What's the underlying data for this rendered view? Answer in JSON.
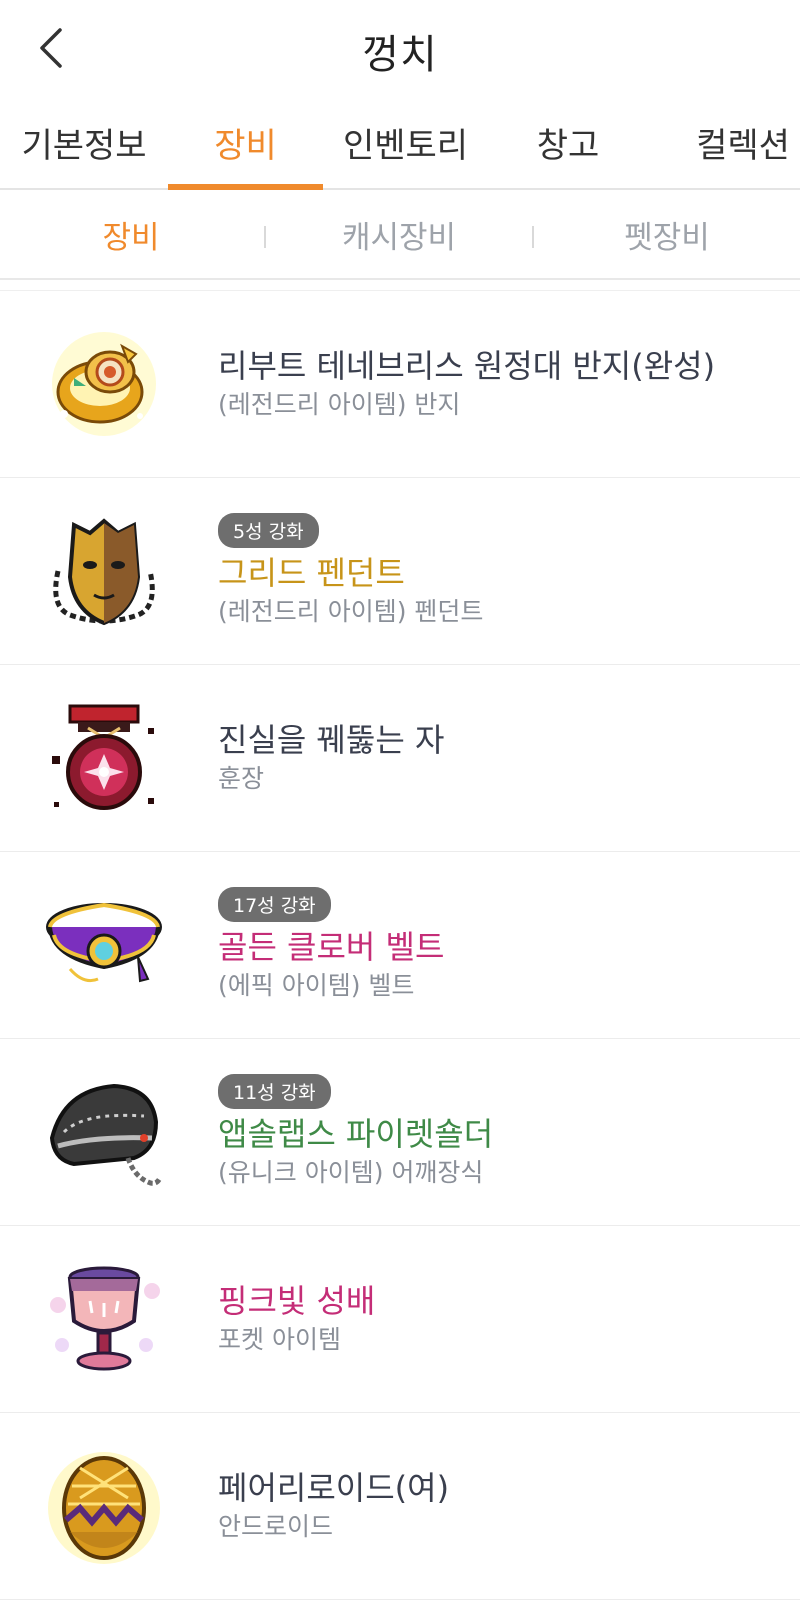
{
  "header": {
    "title": "껑치",
    "back_icon": "chevron-left-icon"
  },
  "main_tabs": [
    {
      "label": "기본정보",
      "active": false
    },
    {
      "label": "장비",
      "active": true
    },
    {
      "label": "인벤토리",
      "active": false
    },
    {
      "label": "창고",
      "active": false
    },
    {
      "label": "컬렉션",
      "active": false
    }
  ],
  "sub_tabs": [
    {
      "label": "장비",
      "active": true
    },
    {
      "label": "캐시장비",
      "active": false
    },
    {
      "label": "펫장비",
      "active": false
    }
  ],
  "colors": {
    "accent": "#f08a2c",
    "legendary": "#c79419",
    "epic": "#c42d77",
    "unique": "#3f8a47",
    "normal": "#3a3f4e",
    "badge": "#6e6e6e"
  },
  "items": [
    {
      "name": "리부트 테네브리스 원정대 반지(완성)",
      "desc": "(레전드리 아이템) 반지",
      "badge": "",
      "icon": "golden-ring-icon",
      "rarity": "normal"
    },
    {
      "name": "그리드 펜던트",
      "desc": "(레전드리 아이템) 펜던트",
      "badge": "5성 강화",
      "icon": "mask-pendant-icon",
      "rarity": "legendary"
    },
    {
      "name": "진실을 꿰뚫는 자",
      "desc": "훈장",
      "badge": "",
      "icon": "medal-icon",
      "rarity": "normal"
    },
    {
      "name": "골든 클로버 벨트",
      "desc": "(에픽 아이템) 벨트",
      "badge": "17성 강화",
      "icon": "belt-icon",
      "rarity": "epic"
    },
    {
      "name": "앱솔랩스 파이렛숄더",
      "desc": "(유니크 아이템) 어깨장식",
      "badge": "11성 강화",
      "icon": "shoulder-icon",
      "rarity": "unique"
    },
    {
      "name": "핑크빛 성배",
      "desc": "포켓 아이템",
      "badge": "",
      "icon": "goblet-icon",
      "rarity": "pocket"
    },
    {
      "name": "페어리로이드(여)",
      "desc": "안드로이드",
      "badge": "",
      "icon": "golden-egg-icon",
      "rarity": "normal"
    }
  ]
}
